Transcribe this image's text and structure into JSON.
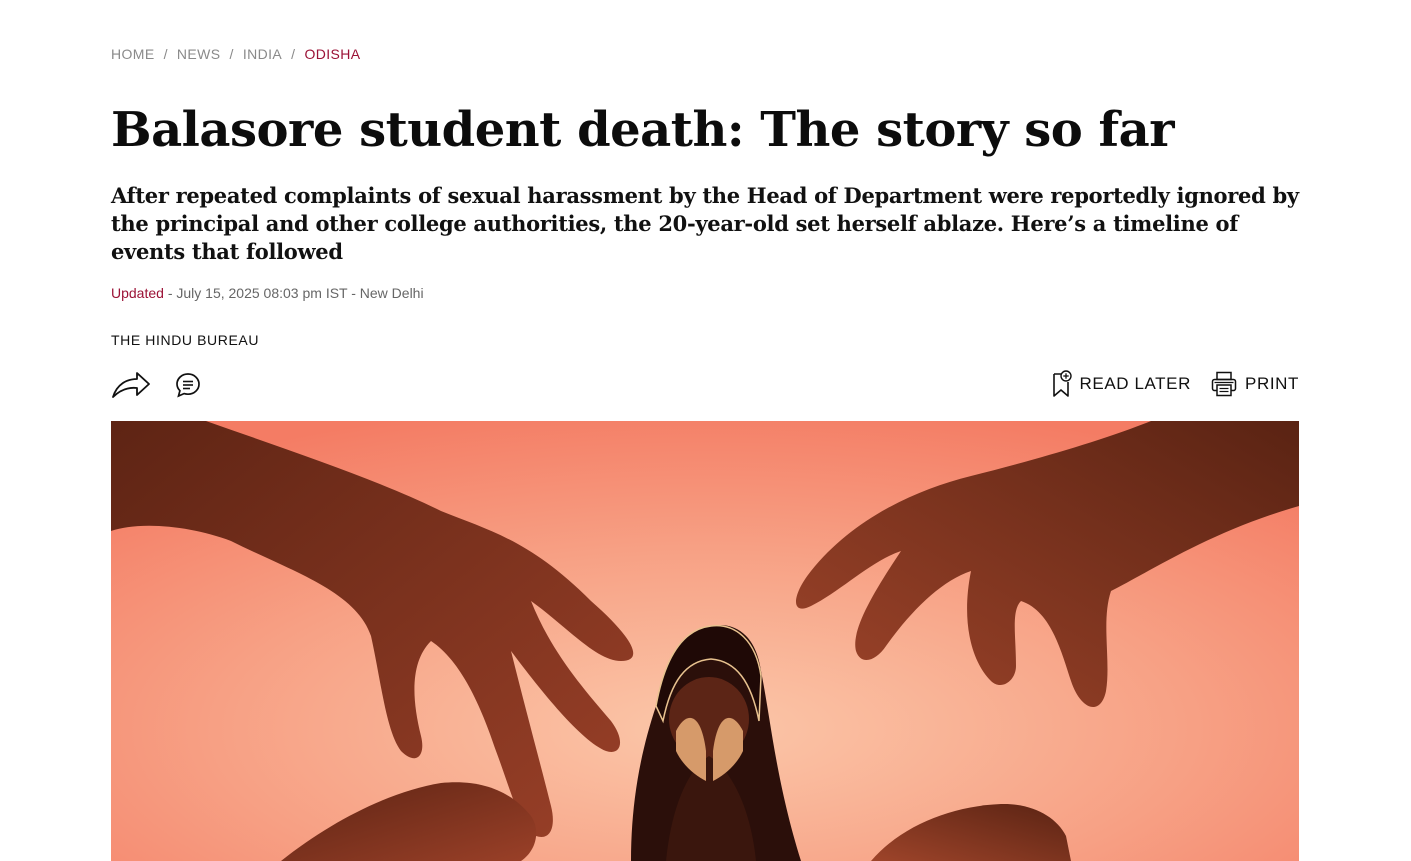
{
  "breadcrumb": {
    "items": [
      "HOME",
      "NEWS",
      "INDIA",
      "ODISHA"
    ],
    "separator": "/"
  },
  "article": {
    "title": "Balasore student death: The story so far",
    "subtitle": "After repeated complaints of sexual harassment by the Head of Department were reportedly ignored by the principal and other college authorities, the 20-year-old set herself ablaze. Here’s a timeline of events that followed",
    "updated_label": "Updated",
    "updated_text": " - July 15, 2025 08:03 pm IST - New Delhi",
    "author": "THE HINDU BUREAU"
  },
  "actions": {
    "read_later": "READ LATER",
    "print": "PRINT"
  },
  "icons": {
    "share": "share-icon",
    "comment": "comment-icon",
    "bookmark": "bookmark-add-icon",
    "print": "printer-icon"
  },
  "colors": {
    "accent": "#9b1236",
    "breadcrumb_gray": "#8a8a8a",
    "meta_gray": "#666666",
    "hero_background": "#f4937a",
    "hero_hands": "#7a3220"
  }
}
